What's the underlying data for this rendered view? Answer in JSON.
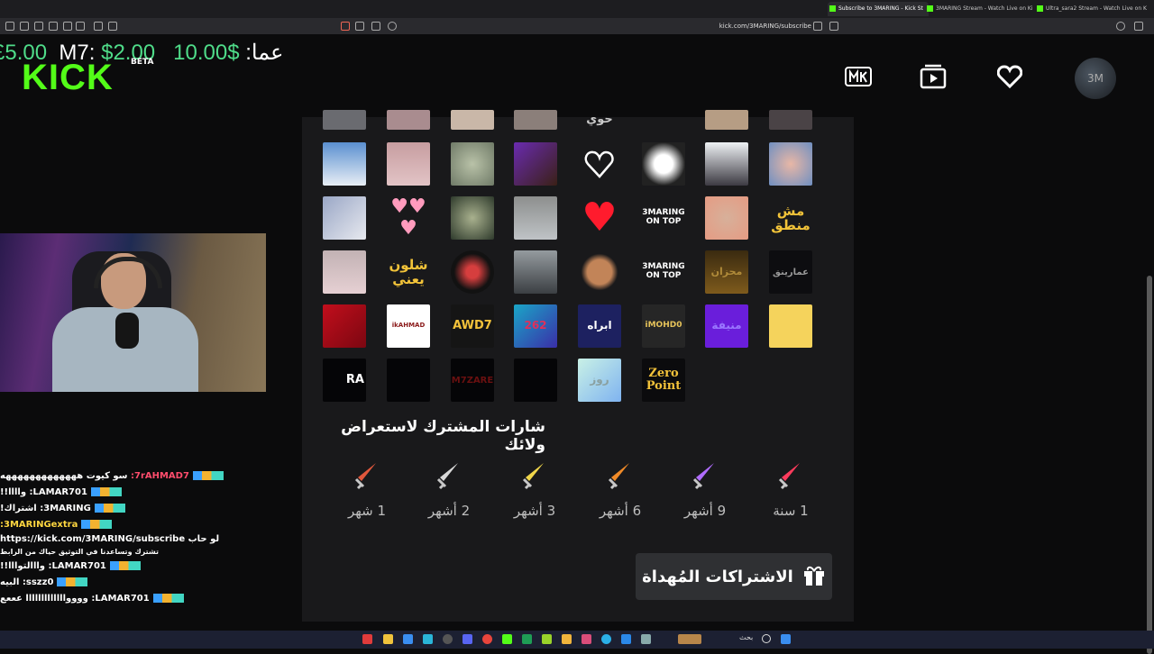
{
  "browser": {
    "tabs": [
      {
        "label": "Subscribe to 3MARING - Kick St",
        "active": true
      },
      {
        "label": "3MARING Stream - Watch Live on Ki",
        "active": false
      },
      {
        "label": "Ultra_sara2 Stream - Watch Live on K",
        "active": false
      }
    ],
    "url": "kick.com/3MARING/subscribe"
  },
  "ticker": {
    "value_left": "£5.00",
    "label_m7": "M7:",
    "value_m7": "$2.00",
    "value_right": "10.00$",
    "label_amma": ":عما"
  },
  "header": {
    "logo": "KICK",
    "beta": "BETA",
    "avatar_text": "3M"
  },
  "emotes": {
    "top_row_text": "حوي",
    "row4_col2": "مش منطق",
    "row2": {
      "ontop": "3MARING ON TOP"
    },
    "row3": {
      "shlon": "شلون يعني",
      "ontop": "3MARING ON TOP",
      "mhzan": "محزان",
      "amarinq": "عمارينق"
    },
    "row4": {
      "ikahmad": "ikAHMAD",
      "awd7": "AWD7",
      "n262": "262",
      "ibrah": "ابراه",
      "imohd": "iMOHD0",
      "munifa": "منيفة"
    },
    "row5": {
      "ra": "RA",
      "m7zare": "M7ZARE",
      "rooz": "روز",
      "zero": "Zero Point"
    }
  },
  "badges": {
    "title": "شارات المشترك لاستعراض ولائك",
    "items": [
      {
        "label": "1 شهر",
        "color": "#e0573c"
      },
      {
        "label": "2 أشهر",
        "color": "#d8d8d8"
      },
      {
        "label": "3 أشهر",
        "color": "#f0d64a"
      },
      {
        "label": "6 أشهر",
        "color": "#f08a28"
      },
      {
        "label": "9 أشهر",
        "color": "#b06cff"
      },
      {
        "label": "1 سنة",
        "color": "#ff3b5c"
      }
    ]
  },
  "gift_button": {
    "label": "الاشتراكات المُهداة"
  },
  "chat": [
    {
      "user": "7rAHMAD7:",
      "msg": "سو كيوت هههههههههههههه",
      "color": "#ff4d6d"
    },
    {
      "user": "LAMAR701:",
      "msg": "واااا!!",
      "color": "#ffffff"
    },
    {
      "user": "3MARING:",
      "msg": "اشتراك!",
      "color": "#ffffff"
    },
    {
      "user": "3MARINGextra:",
      "msg": "",
      "color": "#ffd740"
    },
    {
      "user": "",
      "msg": "لو حاب https://kick.com/3MARING/subscribe",
      "color": "#ffffff"
    },
    {
      "user": "",
      "msg": "تشترك وتساعدنا في التوثيق حياك من الرابط",
      "color": "#ffffff"
    },
    {
      "user": "LAMAR701:",
      "msg": "وااالتوااا!!",
      "color": "#ffffff"
    },
    {
      "user": "sszz0:",
      "msg": "البيه",
      "color": "#ffffff"
    },
    {
      "user": "LAMAR701:",
      "msg": "ووووااااااااااااا عععع",
      "color": "#ffffff"
    }
  ],
  "taskbar": {
    "search": "بحث"
  }
}
